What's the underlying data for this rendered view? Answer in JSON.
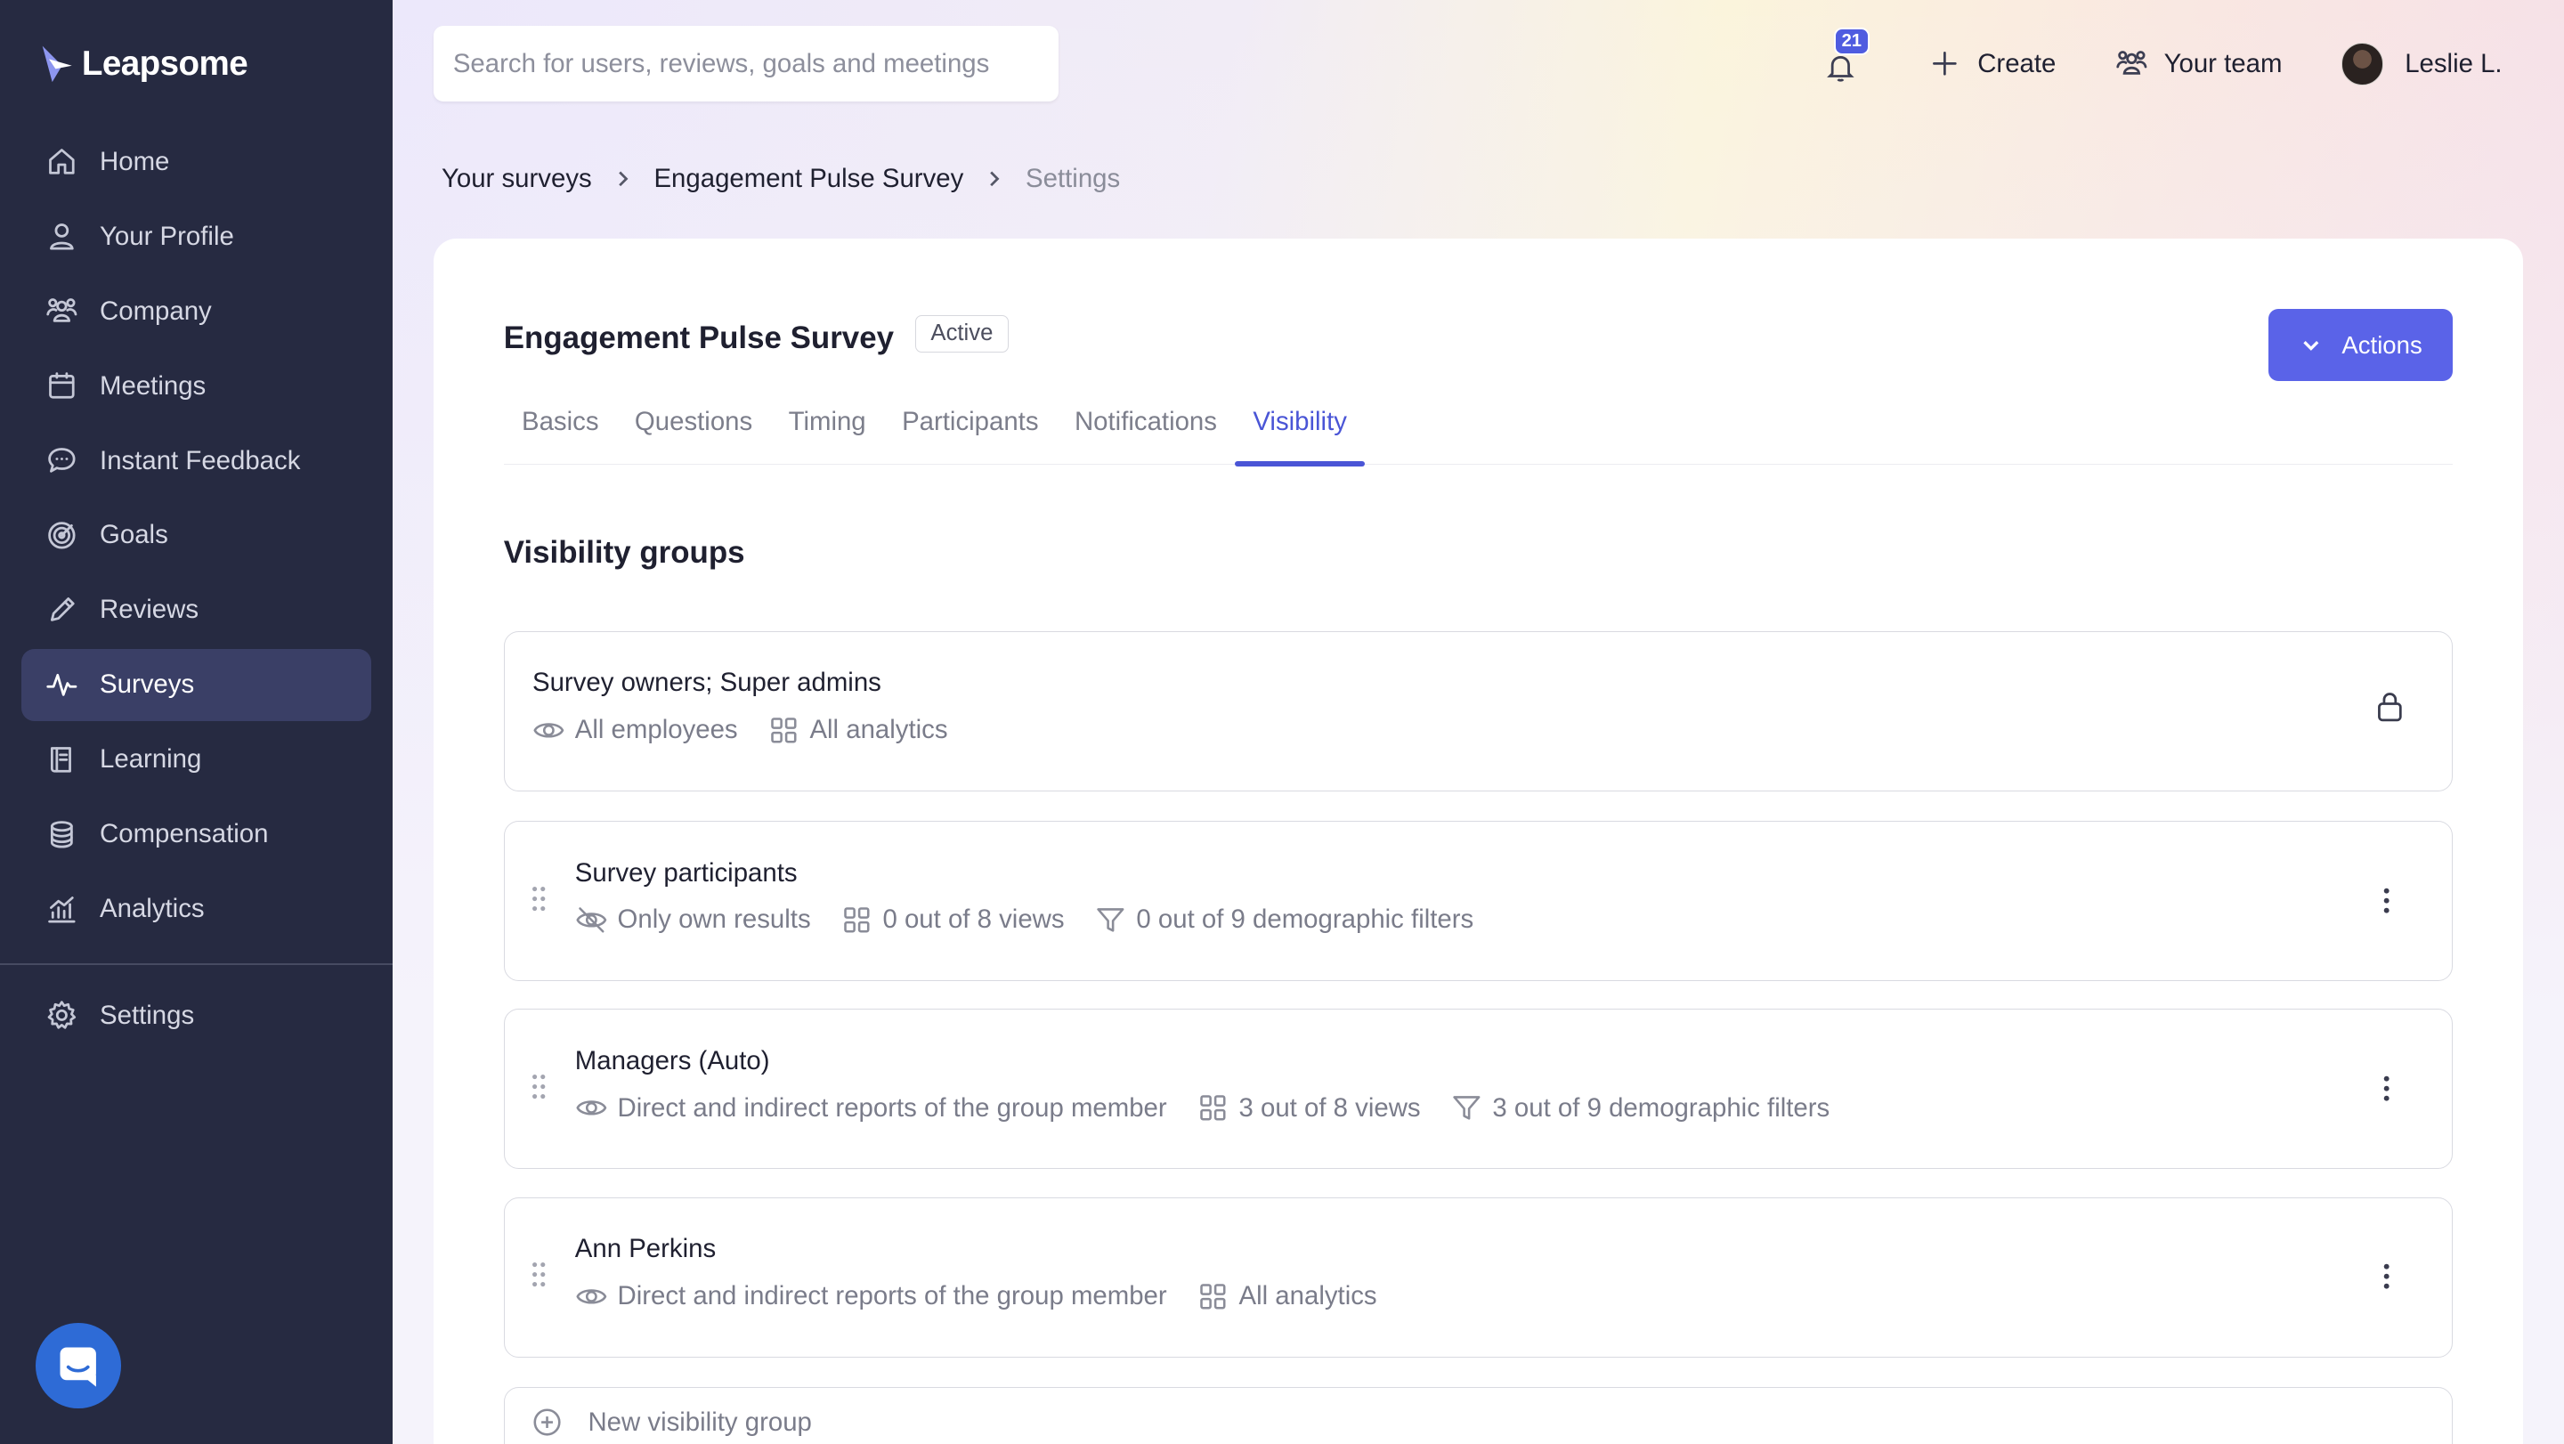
{
  "app": {
    "name": "Leapsome"
  },
  "sidebar": {
    "items": [
      {
        "label": "Home",
        "icon": "home-icon"
      },
      {
        "label": "Your Profile",
        "icon": "user-icon"
      },
      {
        "label": "Company",
        "icon": "people-icon"
      },
      {
        "label": "Meetings",
        "icon": "calendar-icon"
      },
      {
        "label": "Instant Feedback",
        "icon": "chat-bubble-icon"
      },
      {
        "label": "Goals",
        "icon": "target-icon"
      },
      {
        "label": "Reviews",
        "icon": "pencil-icon"
      },
      {
        "label": "Surveys",
        "icon": "pulse-icon",
        "active": true
      },
      {
        "label": "Learning",
        "icon": "book-icon"
      },
      {
        "label": "Compensation",
        "icon": "coins-icon"
      },
      {
        "label": "Analytics",
        "icon": "bar-chart-icon"
      }
    ],
    "settings_label": "Settings",
    "chat_icon": "intercom-chat-icon"
  },
  "header": {
    "search_placeholder": "Search for users, reviews, goals and meetings",
    "notifications_count": "21",
    "create_label": "Create",
    "team_label": "Your team",
    "user_name": "Leslie L."
  },
  "breadcrumb": [
    "Your surveys",
    "Engagement Pulse Survey",
    "Settings"
  ],
  "survey": {
    "title": "Engagement Pulse Survey",
    "status": "Active",
    "actions_label": "Actions",
    "tabs": [
      "Basics",
      "Questions",
      "Timing",
      "Participants",
      "Notifications",
      "Visibility"
    ],
    "active_tab": "Visibility"
  },
  "visibility": {
    "section_title": "Visibility groups",
    "groups": [
      {
        "name": "Survey owners; Super admins",
        "scope": "All employees",
        "views": "All analytics",
        "locked": true
      },
      {
        "name": "Survey participants",
        "scope": "Only own results",
        "views": "0 out of 8 views",
        "filters": "0 out of 9 demographic filters"
      },
      {
        "name": "Managers (Auto)",
        "scope": "Direct and indirect reports of the group member",
        "views": "3 out of 8 views",
        "filters": "3 out of 9 demographic filters"
      },
      {
        "name": "Ann Perkins",
        "scope": "Direct and indirect reports of the group member",
        "views": "All analytics"
      }
    ],
    "new_group_label": "New visibility group"
  },
  "colors": {
    "sidebar_bg": "#262a41",
    "sidebar_active": "#3a3f66",
    "accent": "#5a63e8",
    "tab_active": "#4a55d6"
  }
}
